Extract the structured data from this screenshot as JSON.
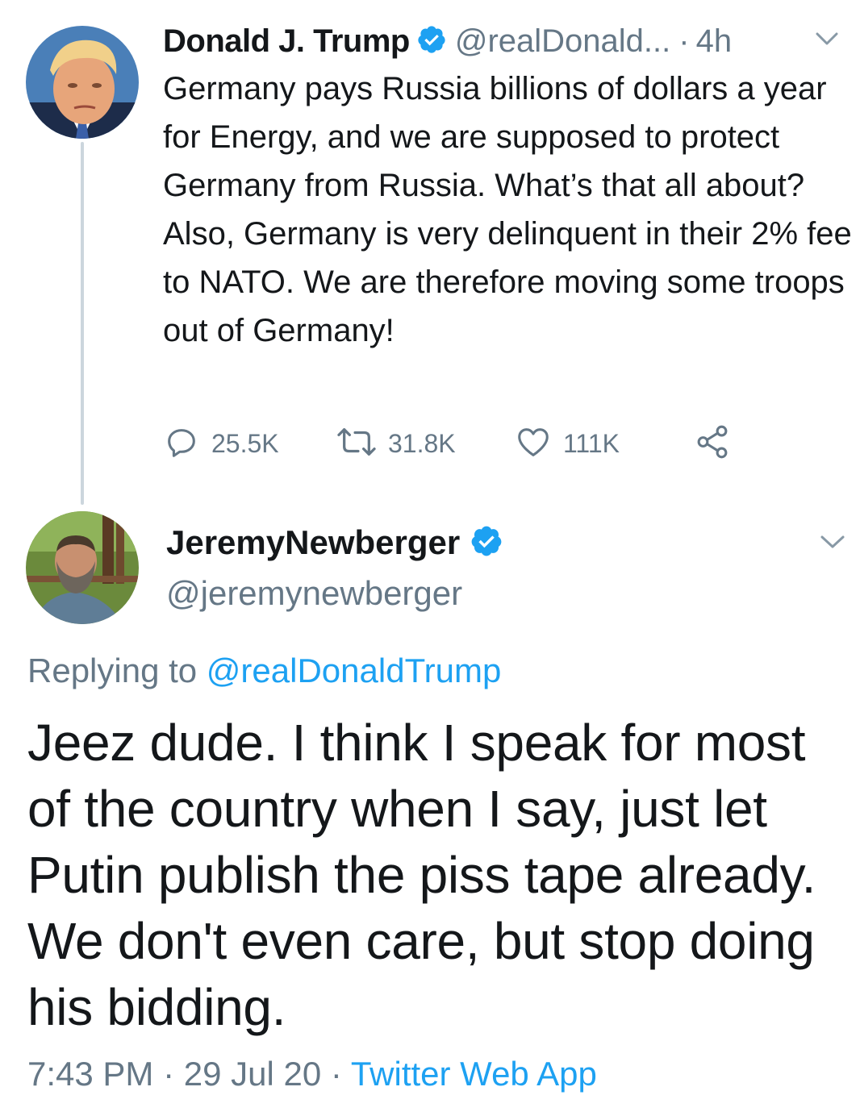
{
  "parent_tweet": {
    "display_name": "Donald J. Trump",
    "handle": "@realDonald...",
    "separator": "·",
    "time_ago": "4h",
    "text": "Germany pays Russia billions of dollars a year for Energy, and we are supposed to protect Germany from Russia. What’s that all about? Also, Germany is very delinquent in their 2% fee to NATO. We are therefore moving some troops out of Germany!",
    "replies_count": "25.5K",
    "retweets_count": "31.8K",
    "likes_count": "111K",
    "icons": [
      "verified-badge-icon",
      "chevron-down-icon",
      "reply-icon",
      "retweet-icon",
      "like-icon",
      "share-icon"
    ]
  },
  "reply_tweet": {
    "display_name": "JeremyNewberger",
    "handle": "@jeremynewberger",
    "replying_prefix": "Replying to",
    "replying_mention": "@realDonaldTrump",
    "text": "Jeez dude. I think I speak for most of the country when I say, just let Putin publish the piss tape already. We don't even care, but stop doing his bidding.",
    "time": "7:43 PM",
    "date": "29 Jul 20",
    "separator": "·",
    "source": "Twitter Web App"
  },
  "colors": {
    "text_primary": "#14171a",
    "text_secondary": "#657786",
    "accent_blue": "#1da1f2",
    "thread_line": "#ccd6dd"
  }
}
